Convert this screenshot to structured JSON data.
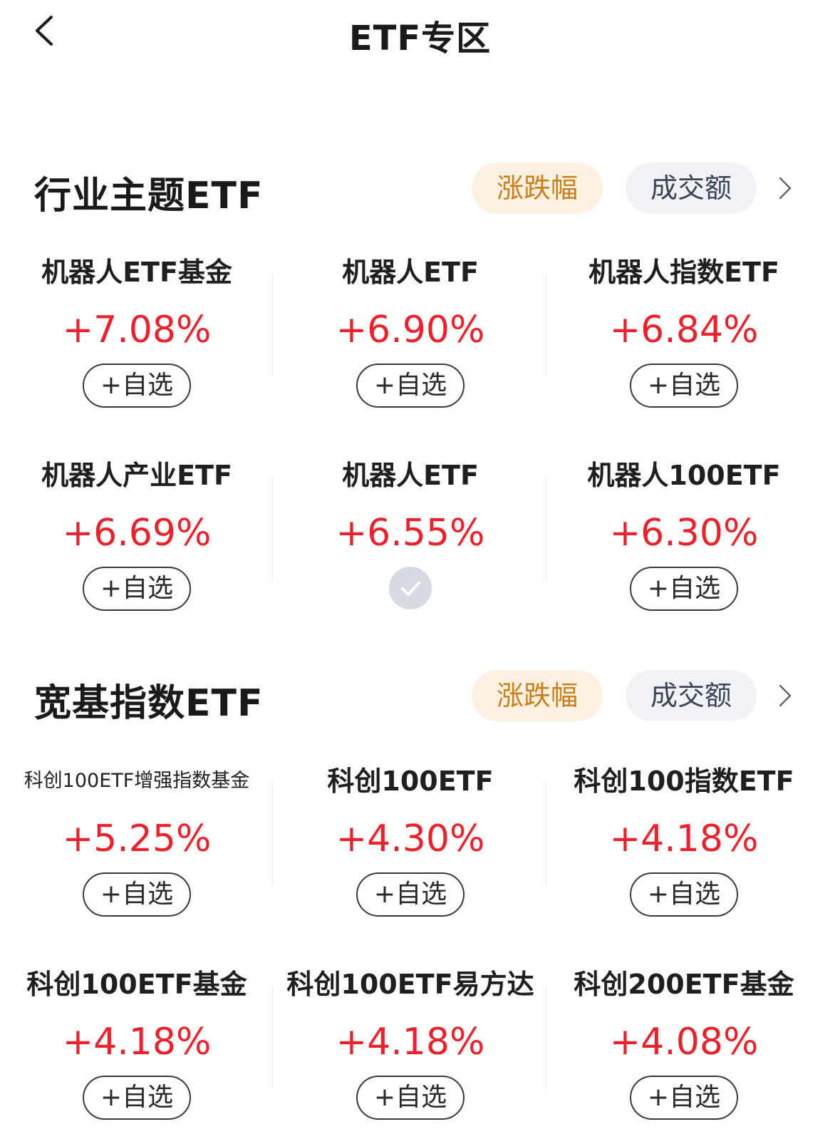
{
  "nav": {
    "title": "ETF专区",
    "back_icon": "chevron-left-icon"
  },
  "colors": {
    "up": "#e8232e",
    "accent": "#c8801e",
    "accent_bg": "#fdf0e0",
    "pill_bg": "#f0f2f6"
  },
  "sections": [
    {
      "title": "行业主题ETF",
      "sort_active": "涨跌幅",
      "sort_inactive": "成交额",
      "items": [
        {
          "name": "机器人ETF基金",
          "change": "+7.08%",
          "action": "+自选",
          "added": false
        },
        {
          "name": "机器人ETF",
          "change": "+6.90%",
          "action": "+自选",
          "added": false
        },
        {
          "name": "机器人指数ETF",
          "change": "+6.84%",
          "action": "+自选",
          "added": false
        },
        {
          "name": "机器人产业ETF",
          "change": "+6.69%",
          "action": "+自选",
          "added": false
        },
        {
          "name": "机器人ETF",
          "change": "+6.55%",
          "action": "",
          "added": true
        },
        {
          "name": "机器人100ETF",
          "change": "+6.30%",
          "action": "+自选",
          "added": false
        }
      ]
    },
    {
      "title": "宽基指数ETF",
      "sort_active": "涨跌幅",
      "sort_inactive": "成交额",
      "items": [
        {
          "name": "科创100ETF增强指数基金",
          "change": "+5.25%",
          "action": "+自选",
          "added": false
        },
        {
          "name": "科创100ETF",
          "change": "+4.30%",
          "action": "+自选",
          "added": false
        },
        {
          "name": "科创100指数ETF",
          "change": "+4.18%",
          "action": "+自选",
          "added": false
        },
        {
          "name": "科创100ETF基金",
          "change": "+4.18%",
          "action": "+自选",
          "added": false
        },
        {
          "name": "科创100ETF易方达",
          "change": "+4.18%",
          "action": "+自选",
          "added": false
        },
        {
          "name": "科创200ETF基金",
          "change": "+4.08%",
          "action": "+自选",
          "added": false
        }
      ]
    }
  ]
}
